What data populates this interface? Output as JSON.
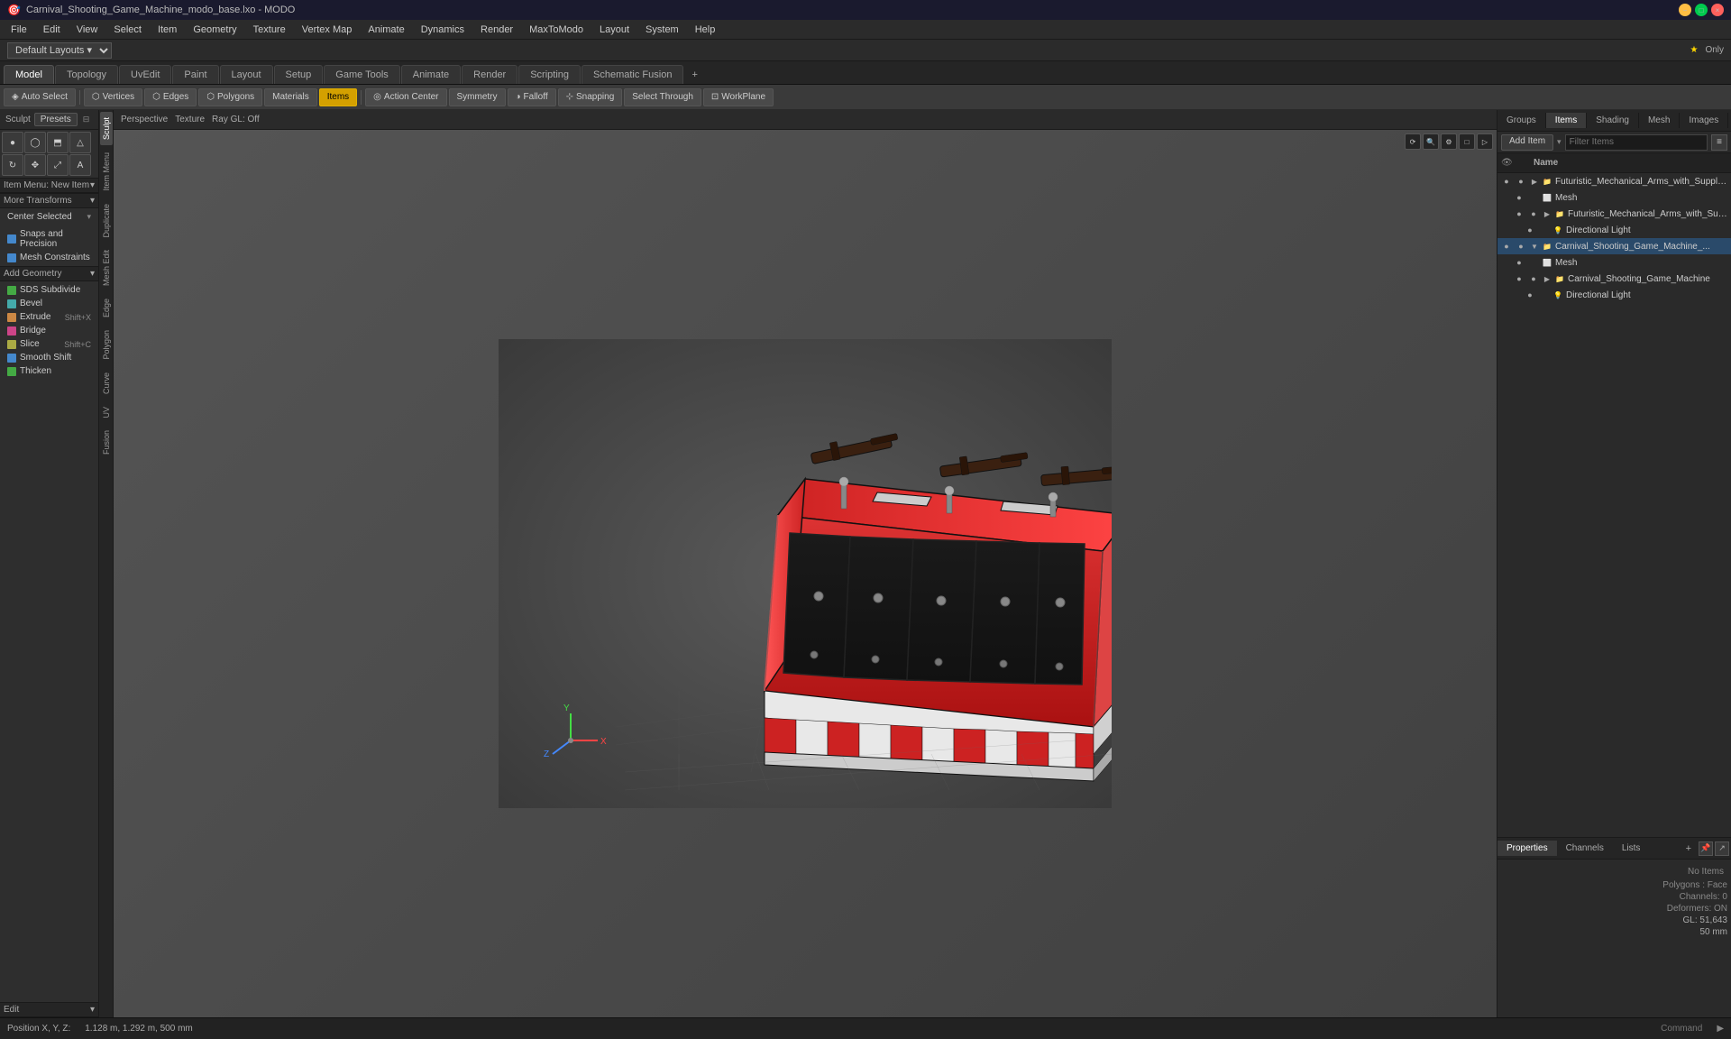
{
  "titleBar": {
    "title": "Carnival_Shooting_Game_Machine_modo_base.lxo - MODO",
    "minBtn": "−",
    "maxBtn": "□",
    "closeBtn": "×"
  },
  "menuBar": {
    "items": [
      "File",
      "Edit",
      "View",
      "Select",
      "Item",
      "Geometry",
      "Texture",
      "Vertex Map",
      "Animate",
      "Dynamics",
      "Render",
      "MaxToModo",
      "Layout",
      "System",
      "Help"
    ]
  },
  "layoutBar": {
    "layoutSelect": "Default Layouts",
    "onlyLabel": "Only"
  },
  "tabBar": {
    "tabs": [
      {
        "label": "Model",
        "active": true
      },
      {
        "label": "Topology",
        "active": false
      },
      {
        "label": "UvEdit",
        "active": false
      },
      {
        "label": "Paint",
        "active": false
      },
      {
        "label": "Layout",
        "active": false
      },
      {
        "label": "Setup",
        "active": false
      },
      {
        "label": "Game Tools",
        "active": false
      },
      {
        "label": "Animate",
        "active": false
      },
      {
        "label": "Render",
        "active": false
      },
      {
        "label": "Scripting",
        "active": false
      },
      {
        "label": "Schematic Fusion",
        "active": false
      }
    ]
  },
  "toolbar": {
    "autoSelect": "Auto Select",
    "vertices": "Vertices",
    "edges": "Edges",
    "polygons": "Polygons",
    "materials": "Materials",
    "items": "Items",
    "actionCenter": "Action Center",
    "symmetry": "Symmetry",
    "falloff": "Falloff",
    "snapping": "Snapping",
    "selectThrough": "Select Through",
    "workPlane": "WorkPlane"
  },
  "leftPanel": {
    "sculpt": "Sculpt",
    "presets": "Presets",
    "itemMenuLabel": "Item Menu: New Item",
    "moreTransforms": "More Transforms",
    "centerSelected": "Center Selected",
    "snapsAndPrecision": "Snaps and Precision",
    "meshConstraints": "Mesh Constraints",
    "addGeometry": "Add Geometry",
    "sdsSubdivide": "SDS Subdivide",
    "bevel": "Bevel",
    "extrude": "Extrude",
    "extrudeShortcut": "Shift+X",
    "bridge": "Bridge",
    "slice": "Slice",
    "sliceShortcut": "Shift+C",
    "smoothShift": "Smooth Shift",
    "thicken": "Thicken",
    "edit": "Edit",
    "sideTabs": [
      "Sculpt",
      "Item Menu",
      "Duplicate",
      "Mesh Edit",
      "Edge",
      "Polygon",
      "Curve",
      "UV",
      "Fusion"
    ]
  },
  "viewport": {
    "perspective": "Perspective",
    "texture": "Texture",
    "rayGL": "Ray GL: Off",
    "vpButtons": [
      "⟳",
      "🔍",
      "⚙",
      "□",
      "▷"
    ]
  },
  "rightPanel": {
    "tabs": [
      "Groups",
      "Items",
      "Shading",
      "Mesh",
      "Images"
    ],
    "addItem": "Add Item",
    "filterPlaceholder": "Filter Items",
    "colName": "Name",
    "items": [
      {
        "id": 1,
        "name": "Futuristic_Mechanical_Arms_with_Supply_...",
        "type": "group",
        "indent": 0,
        "expanded": true,
        "eye": true
      },
      {
        "id": 2,
        "name": "Mesh",
        "type": "mesh",
        "indent": 1,
        "eye": false
      },
      {
        "id": 3,
        "name": "Futuristic_Mechanical_Arms_with_Suppl...",
        "type": "group",
        "indent": 1,
        "expanded": true,
        "eye": true
      },
      {
        "id": 4,
        "name": "Directional Light",
        "type": "light",
        "indent": 2,
        "eye": false
      },
      {
        "id": 5,
        "name": "Carnival_Shooting_Game_Machine_...",
        "type": "group",
        "indent": 0,
        "expanded": true,
        "eye": true,
        "selected": true
      },
      {
        "id": 6,
        "name": "Mesh",
        "type": "mesh",
        "indent": 1,
        "eye": false
      },
      {
        "id": 7,
        "name": "Carnival_Shooting_Game_Machine",
        "type": "group",
        "indent": 1,
        "expanded": true,
        "eye": true
      },
      {
        "id": 8,
        "name": "Directional Light",
        "type": "light",
        "indent": 2,
        "eye": false
      }
    ]
  },
  "propertiesPanel": {
    "tabs": [
      "Properties",
      "Channels",
      "Lists"
    ],
    "noItems": "No Items",
    "polygonsLabel": "Polygons : Face",
    "channelsLabel": "Channels: 0",
    "deformersLabel": "Deformers: ON",
    "glLabel": "GL: 51,643",
    "mmLabel": "50 mm"
  },
  "statusBar": {
    "position": "Position X, Y, Z:",
    "positionValue": "1.128 m, 1.292 m, 500 mm",
    "commandLabel": "Command"
  }
}
